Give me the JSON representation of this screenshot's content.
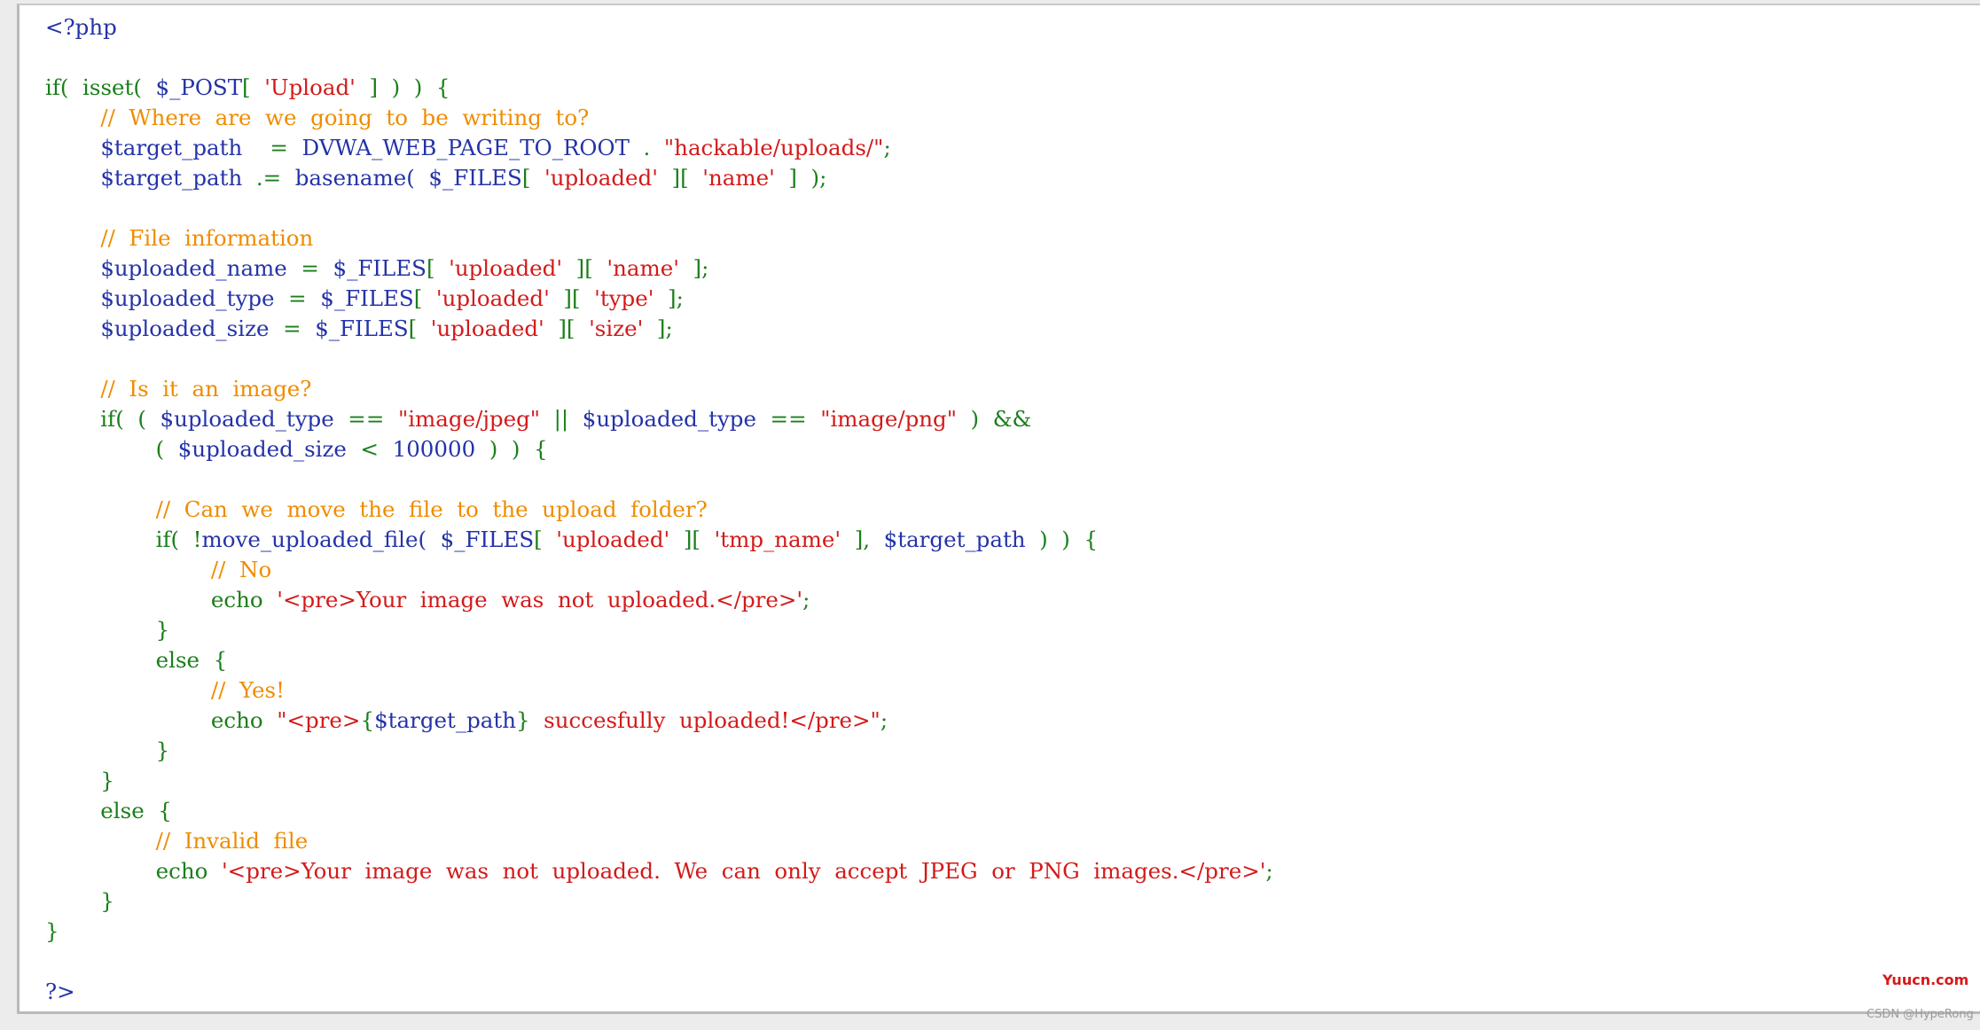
{
  "code_lines": [
    [
      {
        "t": "<?php",
        "c": "var"
      }
    ],
    [],
    [
      {
        "t": "if(  isset(  ",
        "c": "kw"
      },
      {
        "t": "$_POST",
        "c": "var"
      },
      {
        "t": "[  ",
        "c": "kw"
      },
      {
        "t": "'Upload'",
        "c": "str"
      },
      {
        "t": "  ]  )  )  {",
        "c": "kw"
      }
    ],
    [
      {
        "t": "        ",
        "c": "kw"
      },
      {
        "t": "//  Where  are  we  going  to  be  writing  to?",
        "c": "cmt"
      }
    ],
    [
      {
        "t": "        ",
        "c": "kw"
      },
      {
        "t": "$target_path",
        "c": "var"
      },
      {
        "t": "    =  ",
        "c": "kw"
      },
      {
        "t": "DVWA_WEB_PAGE_TO_ROOT",
        "c": "var"
      },
      {
        "t": "  .  ",
        "c": "kw"
      },
      {
        "t": "\"hackable/uploads/\"",
        "c": "str"
      },
      {
        "t": ";",
        "c": "kw"
      }
    ],
    [
      {
        "t": "        ",
        "c": "kw"
      },
      {
        "t": "$target_path",
        "c": "var"
      },
      {
        "t": "  .=  ",
        "c": "kw"
      },
      {
        "t": "basename(  ",
        "c": "var"
      },
      {
        "t": "$_FILES",
        "c": "var"
      },
      {
        "t": "[  ",
        "c": "kw"
      },
      {
        "t": "'uploaded'",
        "c": "str"
      },
      {
        "t": "  ][  ",
        "c": "kw"
      },
      {
        "t": "'name'",
        "c": "str"
      },
      {
        "t": "  ]  );",
        "c": "kw"
      }
    ],
    [],
    [
      {
        "t": "        ",
        "c": "kw"
      },
      {
        "t": "//  File  information",
        "c": "cmt"
      }
    ],
    [
      {
        "t": "        ",
        "c": "kw"
      },
      {
        "t": "$uploaded_name",
        "c": "var"
      },
      {
        "t": "  =  ",
        "c": "kw"
      },
      {
        "t": "$_FILES",
        "c": "var"
      },
      {
        "t": "[  ",
        "c": "kw"
      },
      {
        "t": "'uploaded'",
        "c": "str"
      },
      {
        "t": "  ][  ",
        "c": "kw"
      },
      {
        "t": "'name'",
        "c": "str"
      },
      {
        "t": "  ];",
        "c": "kw"
      }
    ],
    [
      {
        "t": "        ",
        "c": "kw"
      },
      {
        "t": "$uploaded_type",
        "c": "var"
      },
      {
        "t": "  =  ",
        "c": "kw"
      },
      {
        "t": "$_FILES",
        "c": "var"
      },
      {
        "t": "[  ",
        "c": "kw"
      },
      {
        "t": "'uploaded'",
        "c": "str"
      },
      {
        "t": "  ][  ",
        "c": "kw"
      },
      {
        "t": "'type'",
        "c": "str"
      },
      {
        "t": "  ];",
        "c": "kw"
      }
    ],
    [
      {
        "t": "        ",
        "c": "kw"
      },
      {
        "t": "$uploaded_size",
        "c": "var"
      },
      {
        "t": "  =  ",
        "c": "kw"
      },
      {
        "t": "$_FILES",
        "c": "var"
      },
      {
        "t": "[  ",
        "c": "kw"
      },
      {
        "t": "'uploaded'",
        "c": "str"
      },
      {
        "t": "  ][  ",
        "c": "kw"
      },
      {
        "t": "'size'",
        "c": "str"
      },
      {
        "t": "  ];",
        "c": "kw"
      }
    ],
    [],
    [
      {
        "t": "        ",
        "c": "kw"
      },
      {
        "t": "//  Is  it  an  image?",
        "c": "cmt"
      }
    ],
    [
      {
        "t": "        if(  (  ",
        "c": "kw"
      },
      {
        "t": "$uploaded_type",
        "c": "var"
      },
      {
        "t": "  ==  ",
        "c": "kw"
      },
      {
        "t": "\"image/jpeg\"",
        "c": "str"
      },
      {
        "t": "  ||  ",
        "c": "kw"
      },
      {
        "t": "$uploaded_type",
        "c": "var"
      },
      {
        "t": "  ==  ",
        "c": "kw"
      },
      {
        "t": "\"image/png\"",
        "c": "str"
      },
      {
        "t": "  )  &&",
        "c": "kw"
      }
    ],
    [
      {
        "t": "                (  ",
        "c": "kw"
      },
      {
        "t": "$uploaded_size",
        "c": "var"
      },
      {
        "t": "  <  ",
        "c": "kw"
      },
      {
        "t": "100000",
        "c": "var"
      },
      {
        "t": "  )  )  {",
        "c": "kw"
      }
    ],
    [],
    [
      {
        "t": "                ",
        "c": "kw"
      },
      {
        "t": "//  Can  we  move  the  file  to  the  upload  folder?",
        "c": "cmt"
      }
    ],
    [
      {
        "t": "                if(  !",
        "c": "kw"
      },
      {
        "t": "move_uploaded_file(  ",
        "c": "var"
      },
      {
        "t": "$_FILES",
        "c": "var"
      },
      {
        "t": "[  ",
        "c": "kw"
      },
      {
        "t": "'uploaded'",
        "c": "str"
      },
      {
        "t": "  ][  ",
        "c": "kw"
      },
      {
        "t": "'tmp_name'",
        "c": "str"
      },
      {
        "t": "  ],  ",
        "c": "kw"
      },
      {
        "t": "$target_path",
        "c": "var"
      },
      {
        "t": "  )  )  {",
        "c": "kw"
      }
    ],
    [
      {
        "t": "                        ",
        "c": "kw"
      },
      {
        "t": "//  No",
        "c": "cmt"
      }
    ],
    [
      {
        "t": "                        echo  ",
        "c": "kw"
      },
      {
        "t": "'<pre>Your  image  was  not  uploaded.</pre>'",
        "c": "str"
      },
      {
        "t": ";",
        "c": "kw"
      }
    ],
    [
      {
        "t": "                }",
        "c": "kw"
      }
    ],
    [
      {
        "t": "                else  {",
        "c": "kw"
      }
    ],
    [
      {
        "t": "                        ",
        "c": "kw"
      },
      {
        "t": "//  Yes!",
        "c": "cmt"
      }
    ],
    [
      {
        "t": "                        echo  ",
        "c": "kw"
      },
      {
        "t": "\"<pre>",
        "c": "str"
      },
      {
        "t": "{",
        "c": "kw"
      },
      {
        "t": "$target_path",
        "c": "var"
      },
      {
        "t": "}",
        "c": "kw"
      },
      {
        "t": "  succesfully  uploaded!</pre>\"",
        "c": "str"
      },
      {
        "t": ";",
        "c": "kw"
      }
    ],
    [
      {
        "t": "                }",
        "c": "kw"
      }
    ],
    [
      {
        "t": "        }",
        "c": "kw"
      }
    ],
    [
      {
        "t": "        else  {",
        "c": "kw"
      }
    ],
    [
      {
        "t": "                ",
        "c": "kw"
      },
      {
        "t": "//  Invalid  file",
        "c": "cmt"
      }
    ],
    [
      {
        "t": "                echo  ",
        "c": "kw"
      },
      {
        "t": "'<pre>Your  image  was  not  uploaded.  We  can  only  accept  JPEG  or  PNG  images.</pre>'",
        "c": "str"
      },
      {
        "t": ";",
        "c": "kw"
      }
    ],
    [
      {
        "t": "        }",
        "c": "kw"
      }
    ],
    [
      {
        "t": "}",
        "c": "kw"
      }
    ],
    [],
    [
      {
        "t": "?>",
        "c": "var"
      }
    ]
  ],
  "watermark": {
    "brand": "Yuucn.com",
    "csdn": "CSDN @HypeRong"
  }
}
